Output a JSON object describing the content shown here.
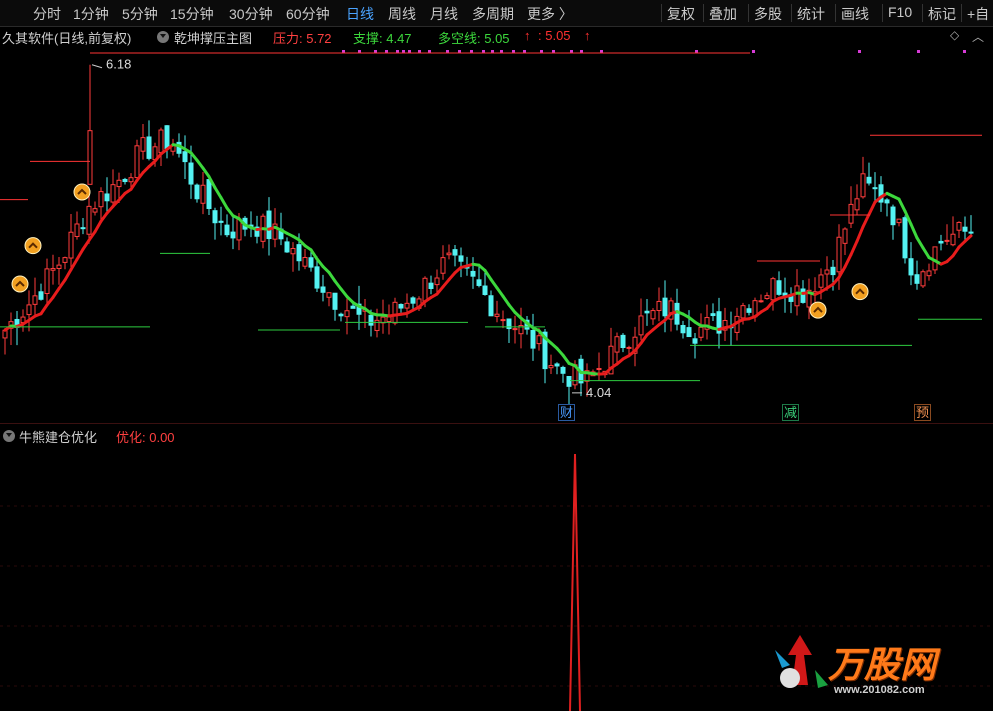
{
  "toolbar": {
    "periods": [
      "分时",
      "1分钟",
      "5分钟",
      "15分钟",
      "30分钟",
      "60分钟",
      "日线",
      "周线",
      "月线",
      "多周期",
      "更多 〉"
    ],
    "active_period": "日线",
    "right_buttons": [
      "复权",
      "叠加",
      "多股",
      "统计",
      "画线",
      "F10",
      "标记",
      "+自"
    ]
  },
  "main_header": {
    "stock": "久其软件(日线,前复权)",
    "indicator": "乾坤撑压主图",
    "pressure_label": "压力: 5.72",
    "support_label": "支撑: 4.47",
    "ls_label": "多空线: 5.05",
    "ls_arrow": "↑",
    "extra_label": ": 5.05",
    "extra_arrow": "↑"
  },
  "annotations": {
    "high_price": "6.18",
    "low_price": "4.04"
  },
  "badges": [
    {
      "text": "财",
      "color": "#2a7de1"
    },
    {
      "text": "减",
      "color": "#27c46b"
    },
    {
      "text": "预",
      "color": "#e07b39"
    }
  ],
  "sub_header": {
    "indicator": "牛熊建仓优化",
    "value_label": "优化: 0.00"
  },
  "watermark": {
    "brand": "万股网",
    "url": "www.201082.com"
  },
  "colors": {
    "up": "#ff3d3d",
    "down": "#54f2f2",
    "ma_up": "#e81c1c",
    "ma_down": "#3cd83c",
    "support": "#2ecc40",
    "pressure": "#ff3535",
    "signal": "#e02020",
    "magenta": "#d63bd6"
  },
  "chart_data": {
    "type": "candlestick",
    "ohlc_sample": [
      [
        4.35,
        4.48,
        4.3,
        4.45
      ],
      [
        4.45,
        4.7,
        4.4,
        4.65
      ],
      [
        4.62,
        4.95,
        4.58,
        4.9
      ],
      [
        4.9,
        5.3,
        4.85,
        5.25
      ],
      [
        5.25,
        5.55,
        5.1,
        5.4
      ],
      [
        5.4,
        5.7,
        5.3,
        5.62
      ],
      [
        5.6,
        6.18,
        5.55,
        5.7
      ],
      [
        5.7,
        5.75,
        5.3,
        5.35
      ],
      [
        5.35,
        5.4,
        5.05,
        5.1
      ],
      [
        5.1,
        5.2,
        4.95,
        5.15
      ],
      [
        5.15,
        5.3,
        5.0,
        5.05
      ],
      [
        5.05,
        5.1,
        4.8,
        4.85
      ],
      [
        4.85,
        4.9,
        4.6,
        4.65
      ],
      [
        4.65,
        4.7,
        4.45,
        4.5
      ],
      [
        4.5,
        4.6,
        4.4,
        4.55
      ],
      [
        4.55,
        4.75,
        4.5,
        4.7
      ],
      [
        4.7,
        4.98,
        4.65,
        4.9
      ],
      [
        4.9,
        4.95,
        4.7,
        4.75
      ],
      [
        4.75,
        4.78,
        4.5,
        4.55
      ],
      [
        4.55,
        4.6,
        4.35,
        4.4
      ],
      [
        4.4,
        4.45,
        4.15,
        4.2
      ],
      [
        4.2,
        4.25,
        4.04,
        4.1
      ],
      [
        4.1,
        4.35,
        4.08,
        4.3
      ],
      [
        4.3,
        4.55,
        4.25,
        4.5
      ],
      [
        4.5,
        4.7,
        4.45,
        4.6
      ],
      [
        4.6,
        4.65,
        4.4,
        4.45
      ],
      [
        4.45,
        4.55,
        4.38,
        4.5
      ],
      [
        4.5,
        4.7,
        4.45,
        4.65
      ],
      [
        4.65,
        4.8,
        4.6,
        4.75
      ],
      [
        4.75,
        4.85,
        4.6,
        4.7
      ],
      [
        4.7,
        4.95,
        4.65,
        4.9
      ],
      [
        4.9,
        5.5,
        4.85,
        5.4
      ],
      [
        5.4,
        5.72,
        5.2,
        5.3
      ],
      [
        5.3,
        5.35,
        4.7,
        4.8
      ],
      [
        4.8,
        5.1,
        4.75,
        5.05
      ],
      [
        5.05,
        5.2,
        4.95,
        5.1
      ]
    ],
    "price_min": 4.04,
    "price_max": 6.18,
    "pressure": 5.72,
    "support": 4.47,
    "long_short_line": 5.05
  }
}
